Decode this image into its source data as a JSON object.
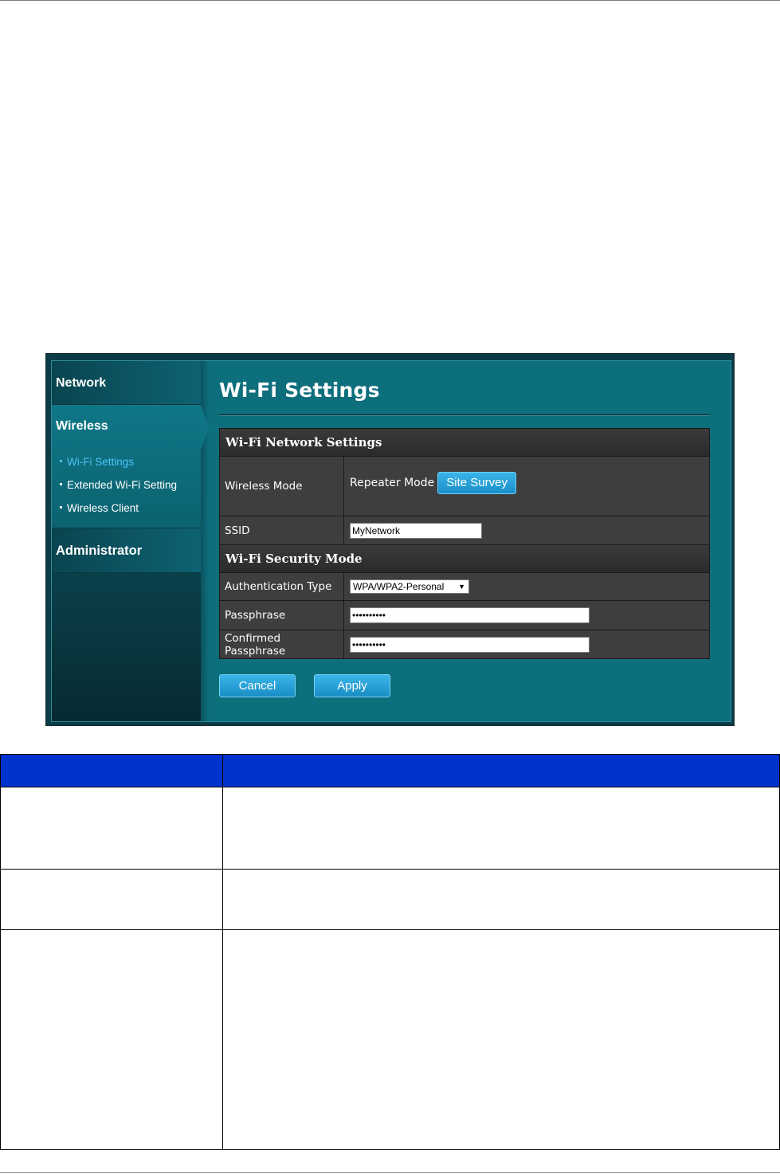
{
  "sidebar": {
    "network": "Network",
    "wireless": "Wireless",
    "items": [
      {
        "label": "Wi-Fi Settings",
        "active": true
      },
      {
        "label": "Extended Wi-Fi Setting",
        "active": false
      },
      {
        "label": "Wireless Client",
        "active": false
      }
    ],
    "administrator": "Administrator"
  },
  "main": {
    "title": "Wi-Fi Settings",
    "network_section": "Wi-Fi Network Settings",
    "wireless_mode_label": "Wireless Mode",
    "wireless_mode_value": "Repeater Mode",
    "site_survey_button": "Site Survey",
    "ssid_label": "SSID",
    "ssid_value": "MyNetwork",
    "security_section": "Wi-Fi Security Mode",
    "auth_type_label": "Authentication Type",
    "auth_type_value": "WPA/WPA2-Personal",
    "passphrase_label": "Passphrase",
    "passphrase_value": "••••••••••",
    "confirmed_passphrase_label": "Confirmed Passphrase",
    "confirmed_passphrase_value": "••••••••••",
    "cancel_button": "Cancel",
    "apply_button": "Apply"
  },
  "colors": {
    "panel_bg": "#0d6e7c",
    "table_bg": "#3e3e3e",
    "button_blue": "#1a8fc7",
    "active_link": "#4fc3f7",
    "doc_header": "#0033cc"
  }
}
